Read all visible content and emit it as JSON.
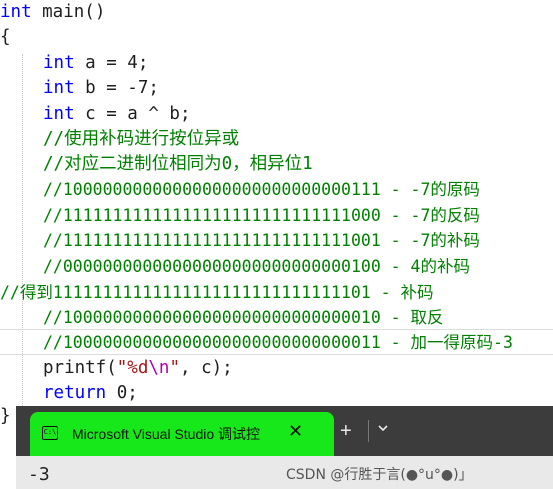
{
  "code": {
    "line1_type": "int",
    "line1_rest": " main()",
    "line2": "{",
    "line3_type": "int",
    "line3_rest": " a = 4;",
    "line4_type": "int",
    "line4_rest": " b = -7;",
    "line5_type": "int",
    "line5_rest": " c = a ^ b;",
    "comment1": "//使用补码进行按位异或",
    "comment2": "//对应二进制位相同为0，相异位1",
    "comment3": "//10000000000000000000000000000111 - -7的原码",
    "comment4": "//11111111111111111111111111111000 - -7的反码",
    "comment5": "//11111111111111111111111111111001 - -7的补码",
    "comment6": "//00000000000000000000000000000100 - 4的补码",
    "comment7": "//得到11111111111111111111111111111101 - 补码",
    "comment8": "//10000000000000000000000000000010 - 取反",
    "comment9": "//10000000000000000000000000000011 - 加一得原码-3",
    "printf_fn": "printf(",
    "printf_str1": "\"%d",
    "printf_esc": "\\n",
    "printf_str2": "\"",
    "printf_rest": ", c);",
    "return_kw": "return",
    "return_rest": " 0;",
    "closing": "}"
  },
  "terminal": {
    "tab_title": "Microsoft Visual Studio 调试控",
    "tab_icon_text": "C:\\",
    "close_glyph": "✕",
    "new_tab_glyph": "+",
    "output": "-3"
  },
  "watermark": "CSDN @行胜于言(●°u°●)​」"
}
